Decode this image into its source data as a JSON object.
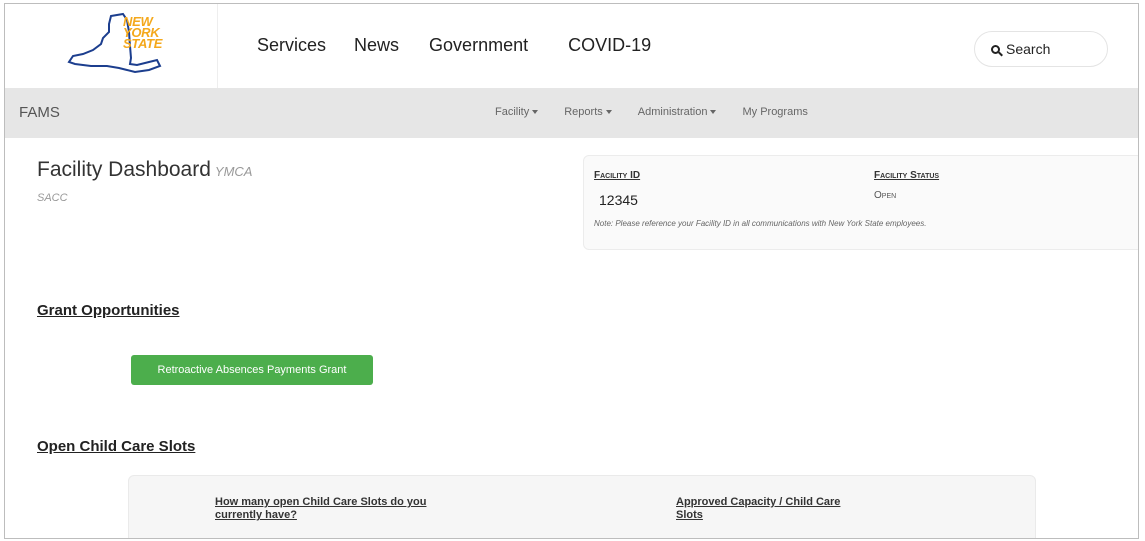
{
  "header": {
    "logo": {
      "line1": "NEW",
      "line2": "YORK",
      "line3": "STATE",
      "color": "#f4a81c"
    },
    "nav": [
      "Services",
      "News",
      "Government",
      "COVID-19"
    ],
    "search_label": "Search"
  },
  "subnav": {
    "brand": "FAMS",
    "menu": [
      {
        "label": "Facility",
        "has_dropdown": true
      },
      {
        "label": "Reports",
        "has_dropdown": true
      },
      {
        "label": "Administration",
        "has_dropdown": true
      },
      {
        "label": "My Programs",
        "has_dropdown": false
      }
    ]
  },
  "dashboard": {
    "title": "Facility Dashboard",
    "facility_name": "YMCA",
    "facility_type": "SACC"
  },
  "facility_card": {
    "id_label": "Facility ID",
    "id_value": "12345",
    "status_label": "Facility Status",
    "status_value": "Open",
    "note": "Note: Please reference your Facility ID in all communications with New York State employees."
  },
  "grants": {
    "heading": "Grant Opportunities",
    "button_label": "Retroactive Absences Payments Grant",
    "button_color": "#4cae4c"
  },
  "slots": {
    "heading": "Open Child Care Slots",
    "question1": "How many open Child Care Slots do you currently have?",
    "question2": "Approved Capacity / Child Care Slots"
  }
}
